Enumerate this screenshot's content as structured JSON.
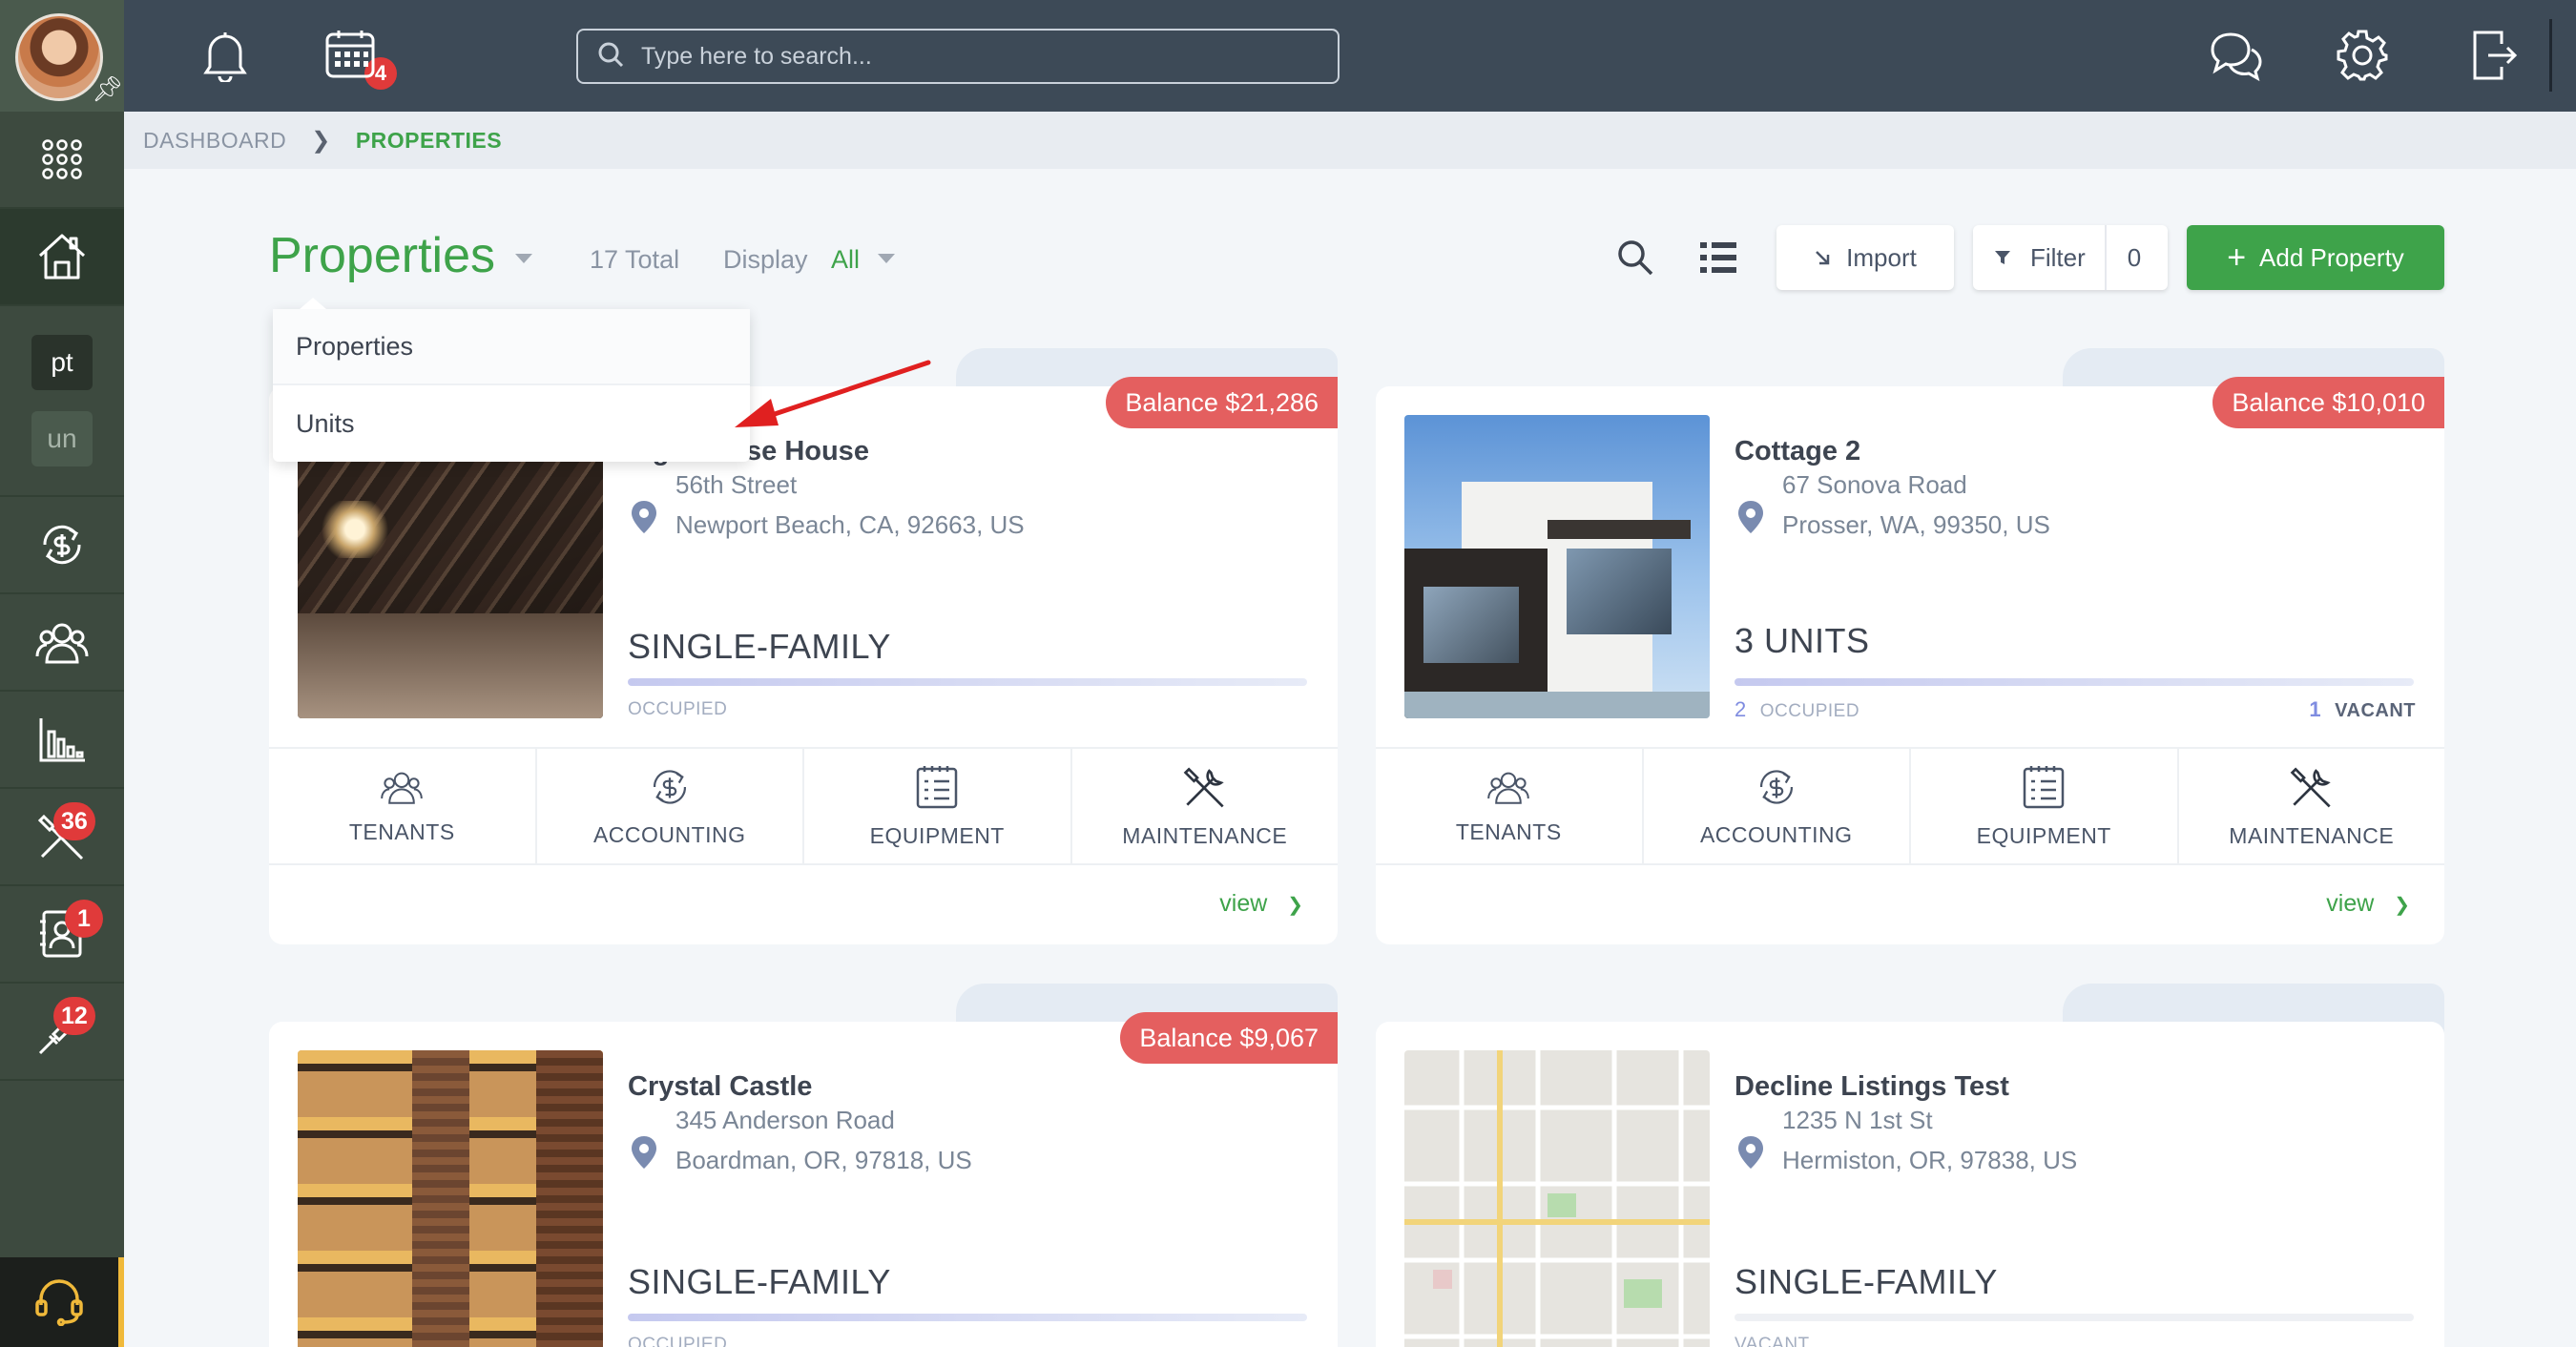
{
  "topbar": {
    "notification_count": "4",
    "search_placeholder": "Type here to search..."
  },
  "sidebar": {
    "chips": [
      "pt",
      "un"
    ],
    "badges": {
      "maintenance": "36",
      "tenant_requests": "1",
      "tools": "12"
    }
  },
  "breadcrumb": {
    "items": [
      "DASHBOARD",
      "PROPERTIES"
    ]
  },
  "header": {
    "title": "Properties",
    "total": "17 Total",
    "display_label": "Display",
    "display_value": "All",
    "import_label": "Import",
    "filter_label": "Filter",
    "filter_count": "0",
    "add_label": "Add Property"
  },
  "dropdown": {
    "items": [
      "Properties",
      "Units"
    ]
  },
  "actions": [
    "TENANTS",
    "ACCOUNTING",
    "EQUIPMENT",
    "MAINTENANCE"
  ],
  "view_label": "view",
  "cards": [
    {
      "name": "Lighthouse House",
      "balance": "Balance $21,286",
      "address1": "56th Street",
      "address2": "Newport Beach, CA, 92663, US",
      "type": "SINGLE-FAMILY",
      "status": "OCCUPIED",
      "occupied_count": "",
      "vacant_count": "",
      "vacant_label": ""
    },
    {
      "name": "Cottage 2",
      "balance": "Balance $10,010",
      "address1": "67 Sonova Road",
      "address2": "Prosser, WA, 99350, US",
      "type": "3 UNITS",
      "status": "OCCUPIED",
      "occupied_count": "2",
      "vacant_count": "1",
      "vacant_label": "VACANT"
    },
    {
      "name": "Crystal Castle",
      "balance": "Balance $9,067",
      "address1": "345 Anderson Road",
      "address2": "Boardman, OR, 97818, US",
      "type": "SINGLE-FAMILY",
      "status": "OCCUPIED",
      "occupied_count": "",
      "vacant_count": "",
      "vacant_label": ""
    },
    {
      "name": "Decline Listings Test",
      "balance": "",
      "address1": "1235 N 1st St",
      "address2": "Hermiston, OR, 97838, US",
      "type": "SINGLE-FAMILY",
      "status": "VACANT",
      "occupied_count": "",
      "vacant_count": "",
      "vacant_label": ""
    }
  ],
  "colors": {
    "accent_green": "#3ea34a",
    "balance_red": "#e45f5f",
    "topbar": "#3d4a57",
    "sidebar": "#3d4a3f"
  }
}
